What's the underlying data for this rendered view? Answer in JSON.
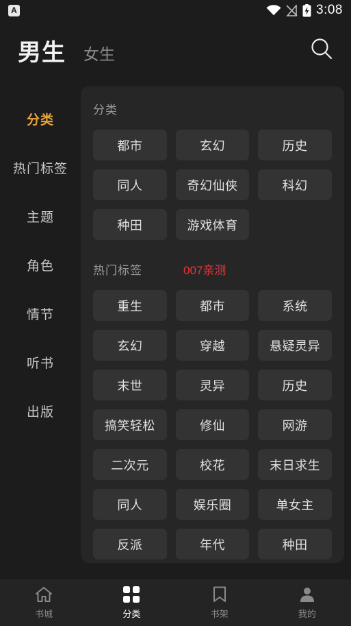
{
  "statusbar": {
    "app_icon_label": "A",
    "time": "3:08",
    "icons": [
      "wifi-icon",
      "signal-off-icon",
      "battery-charging-icon"
    ]
  },
  "header": {
    "tab_main": "男生",
    "tab_sub": "女生",
    "search_icon": "search-icon"
  },
  "sidebar": {
    "items": [
      {
        "label": "分类",
        "active": true
      },
      {
        "label": "热门标签",
        "active": false
      },
      {
        "label": "主题",
        "active": false
      },
      {
        "label": "角色",
        "active": false
      },
      {
        "label": "情节",
        "active": false
      },
      {
        "label": "听书",
        "active": false
      },
      {
        "label": "出版",
        "active": false
      }
    ]
  },
  "panel": {
    "section_category": {
      "title": "分类",
      "chips": [
        "都市",
        "玄幻",
        "历史",
        "同人",
        "奇幻仙侠",
        "科幻",
        "种田",
        "游戏体育"
      ]
    },
    "section_hot": {
      "title": "热门标签",
      "watermark": "007亲测",
      "chips": [
        "重生",
        "都市",
        "系统",
        "玄幻",
        "穿越",
        "悬疑灵异",
        "末世",
        "灵异",
        "历史",
        "搞笑轻松",
        "修仙",
        "网游",
        "二次元",
        "校花",
        "末日求生",
        "同人",
        "娱乐圈",
        "单女主",
        "反派",
        "年代",
        "种田"
      ]
    }
  },
  "bottomnav": {
    "items": [
      {
        "label": "书城",
        "icon": "home-icon",
        "active": false
      },
      {
        "label": "分类",
        "icon": "grid-icon",
        "active": true
      },
      {
        "label": "书架",
        "icon": "bookmark-icon",
        "active": false
      },
      {
        "label": "我的",
        "icon": "person-icon",
        "active": false
      }
    ]
  },
  "colors": {
    "background": "#1c1c1c",
    "panel": "#262626",
    "chip": "#333333",
    "accent": "#e8a33d",
    "watermark": "#e8363b"
  }
}
